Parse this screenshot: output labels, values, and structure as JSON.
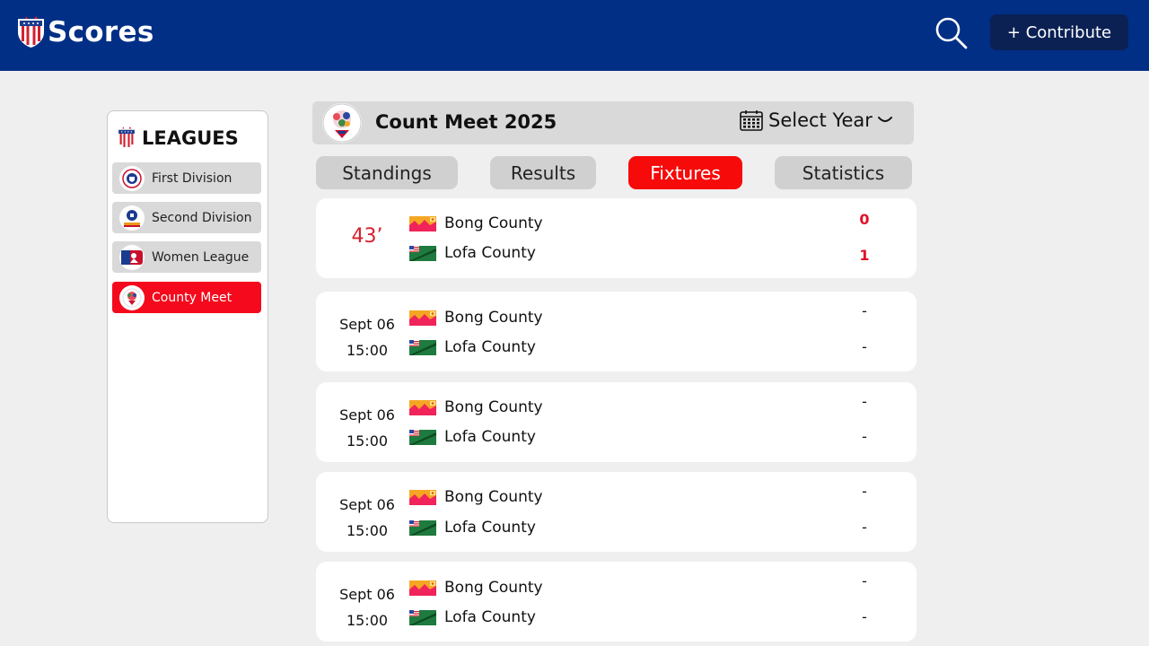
{
  "header": {
    "brand": "Scores",
    "contribute_label": "+ Contribute"
  },
  "sidebar": {
    "title": "LEAGUES",
    "items": [
      {
        "label": "First Division"
      },
      {
        "label": "Second Division"
      },
      {
        "label": "Women League"
      },
      {
        "label": "County Meet"
      }
    ]
  },
  "competition": {
    "title": "Count Meet 2025",
    "year_select_label": "Select Year"
  },
  "tabs": [
    {
      "label": "Standings"
    },
    {
      "label": "Results"
    },
    {
      "label": "Fixtures"
    },
    {
      "label": "Statistics"
    }
  ],
  "matches": [
    {
      "live": "43’",
      "home": "Bong County",
      "away": "Lofa County",
      "home_score": "0",
      "away_score": "1"
    },
    {
      "date": "Sept 06",
      "time": "15:00",
      "home": "Bong County",
      "away": "Lofa County",
      "home_score": "-",
      "away_score": "-"
    },
    {
      "date": "Sept 06",
      "time": "15:00",
      "home": "Bong County",
      "away": "Lofa County",
      "home_score": "-",
      "away_score": "-"
    },
    {
      "date": "Sept 06",
      "time": "15:00",
      "home": "Bong County",
      "away": "Lofa County",
      "home_score": "-",
      "away_score": "-"
    },
    {
      "date": "Sept 06",
      "time": "15:00",
      "home": "Bong County",
      "away": "Lofa County",
      "home_score": "-",
      "away_score": "-"
    }
  ],
  "colors": {
    "header_bg": "#012f86",
    "accent_red": "#f70a0a",
    "live_red": "#d8202e"
  },
  "icons": {
    "brand": "shield-logo-icon",
    "search": "search-icon",
    "calendar": "calendar-icon",
    "chevron": "chevron-down-icon",
    "home_flag": "bong-county-flag-icon",
    "away_flag": "lofa-county-flag-icon"
  }
}
